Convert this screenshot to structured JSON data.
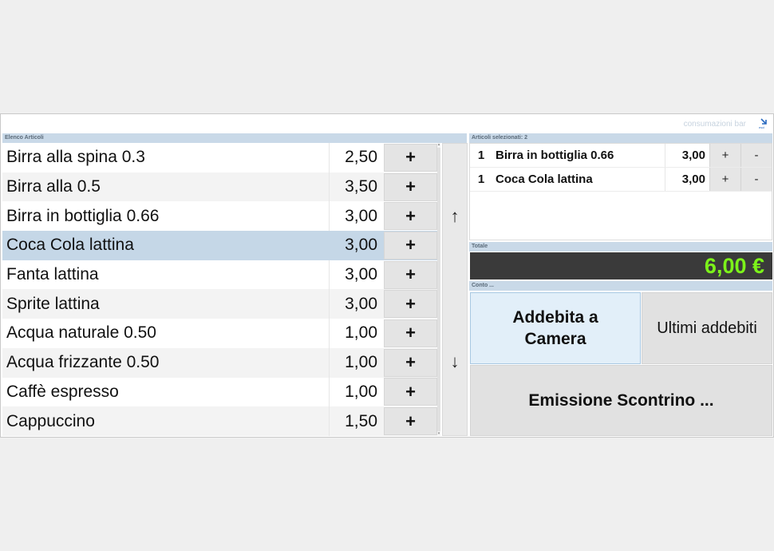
{
  "app": {
    "window_title": "consumazioni bar",
    "exit_icon": "exit-icon",
    "exit_label": "esci"
  },
  "articles": {
    "header": "Elenco Articoli",
    "add_symbol": "+",
    "items": [
      {
        "name": "Birra alla spina 0.3",
        "price": "2,50"
      },
      {
        "name": "Birra alla 0.5",
        "price": "3,50"
      },
      {
        "name": "Birra in bottiglia 0.66",
        "price": "3,00"
      },
      {
        "name": "Coca Cola lattina",
        "price": "3,00"
      },
      {
        "name": "Fanta lattina",
        "price": "3,00"
      },
      {
        "name": "Sprite lattina",
        "price": "3,00"
      },
      {
        "name": "Acqua naturale 0.50",
        "price": "1,00"
      },
      {
        "name": "Acqua frizzante 0.50",
        "price": "1,00"
      },
      {
        "name": "Caffè espresso",
        "price": "1,00"
      },
      {
        "name": "Cappuccino",
        "price": "1,50"
      }
    ],
    "selected_index": 3,
    "scroll_up": "↑",
    "scroll_down": "↓"
  },
  "selected": {
    "header": "Articoli selezionati: 2",
    "plus_symbol": "+",
    "minus_symbol": "-",
    "items": [
      {
        "qty": "1",
        "name": "Birra in bottiglia 0.66",
        "price": "3,00"
      },
      {
        "qty": "1",
        "name": "Coca Cola lattina",
        "price": "3,00"
      }
    ]
  },
  "total": {
    "header": "Totale",
    "value": "6,00 €",
    "color": "#7cf21a"
  },
  "account": {
    "header": "Conto ...",
    "charge_room_label": "Addebita a Camera",
    "last_charges_label": "Ultimi addebiti",
    "receipt_label": "Emissione Scontrino ..."
  },
  "colors": {
    "selected_row": "#c5d7e7",
    "section_header": "#c9d9e8",
    "charge_button": "#e2eff9"
  }
}
